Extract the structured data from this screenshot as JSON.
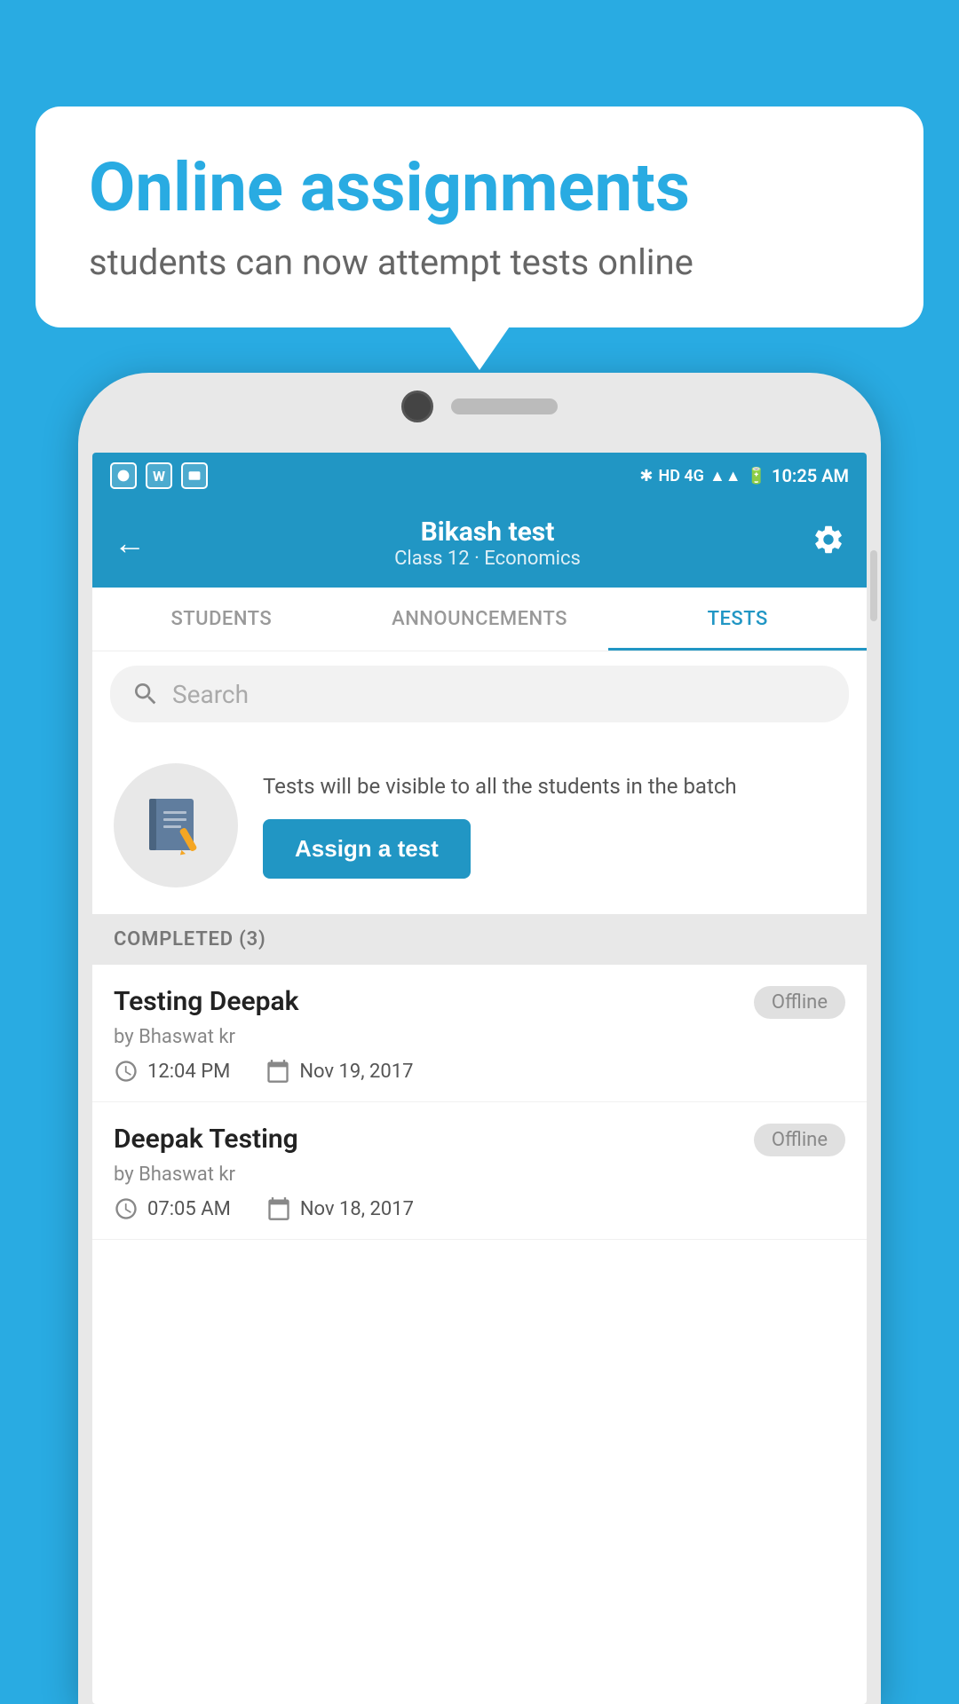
{
  "background_color": "#29abe2",
  "speech_bubble": {
    "title": "Online assignments",
    "subtitle": "students can now attempt tests online"
  },
  "app_bar": {
    "title": "Bikash test",
    "subtitle": "Class 12 · Economics",
    "back_label": "←",
    "settings_label": "⚙"
  },
  "tabs": [
    {
      "label": "STUDENTS",
      "active": false
    },
    {
      "label": "ANNOUNCEMENTS",
      "active": false
    },
    {
      "label": "TESTS",
      "active": true
    }
  ],
  "search": {
    "placeholder": "Search"
  },
  "assign_section": {
    "description": "Tests will be visible to all the students in the batch",
    "button_label": "Assign a test"
  },
  "completed_section": {
    "header": "COMPLETED (3)",
    "tests": [
      {
        "name": "Testing Deepak",
        "by": "by Bhaswat kr",
        "time": "12:04 PM",
        "date": "Nov 19, 2017",
        "status": "Offline"
      },
      {
        "name": "Deepak Testing",
        "by": "by Bhaswat kr",
        "time": "07:05 AM",
        "date": "Nov 18, 2017",
        "status": "Offline"
      }
    ]
  },
  "status_bar": {
    "time": "10:25 AM",
    "network": "HD 4G"
  }
}
